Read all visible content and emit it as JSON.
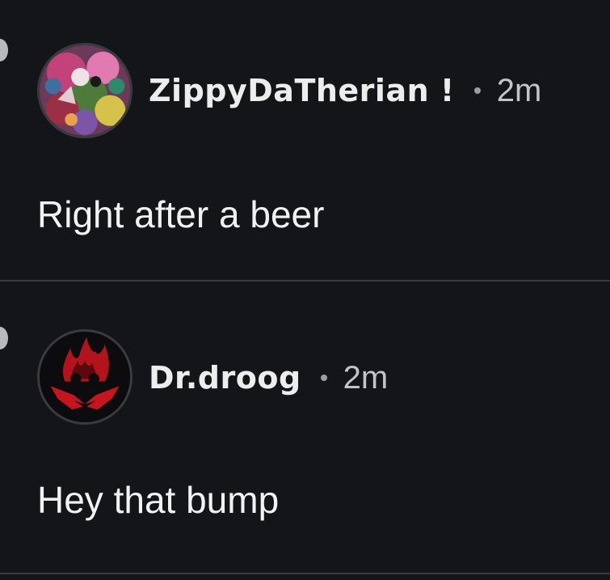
{
  "comments": [
    {
      "username": "ZippyDaTherian !",
      "time": "2m",
      "text": "Right after a beer",
      "avatar_icon": "multicolor-artwork-avatar"
    },
    {
      "username": "Dr.droog",
      "time": "2m",
      "text": "Hey that bump",
      "avatar_icon": "red-flame-mask-avatar"
    }
  ],
  "colors": {
    "background": "#141519",
    "divider": "#3a3b40",
    "username": "#ededed",
    "timestamp": "#c4c4c8",
    "body_text": "#f2f2f2",
    "avatar_red": "#c4161c"
  }
}
